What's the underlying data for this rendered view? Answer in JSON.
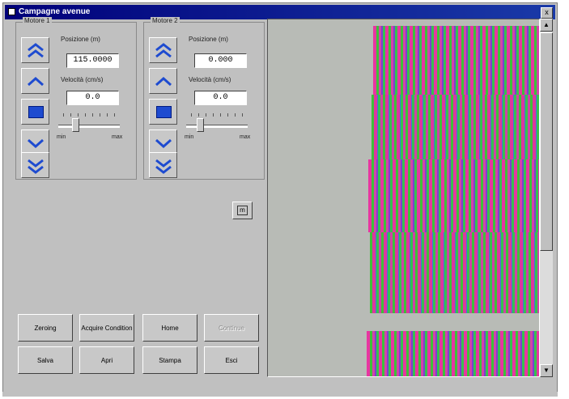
{
  "window": {
    "title": "Campagne avenue",
    "close_label": "x"
  },
  "motor1": {
    "label": "Motore 1",
    "position_label": "Posizione (m)",
    "position_value": "115.0000",
    "speed_label": "Velocità (cm/s)",
    "speed_value": "0.0",
    "slider_min": "min",
    "slider_max": "max",
    "slider_level": 0.25
  },
  "motor2": {
    "label": "Motore 2",
    "position_label": "Posizione (m)",
    "position_value": "0.000",
    "speed_label": "Velocità (cm/s)",
    "speed_value": "0.0",
    "slider_min": "min",
    "slider_max": "max",
    "slider_level": 0.2
  },
  "small_button_label": "m",
  "buttons": {
    "row1": [
      "Zeroing",
      "Acquire Condition",
      "Home",
      "Continue"
    ],
    "row2": [
      "Salva",
      "Apri",
      "Stampa",
      "Esci"
    ]
  },
  "icons": {
    "fast_up": "double-chevron-up-icon",
    "up": "chevron-up-icon",
    "stop": "stop-square-icon",
    "down": "chevron-down-icon",
    "fast_down": "double-chevron-down-icon"
  },
  "colors": {
    "title_bar": "#00007a",
    "stop_blue": "#1e4bd0",
    "stripe_magenta": "#ea2ea0",
    "stripe_green": "#35c234"
  }
}
